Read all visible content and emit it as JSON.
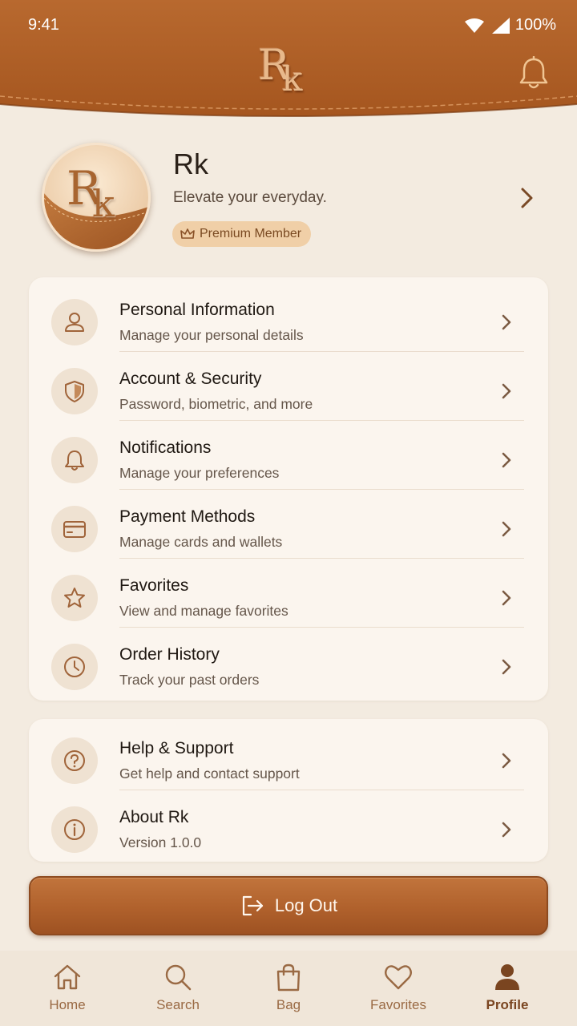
{
  "status_bar": {
    "time": "9:41",
    "battery": "100%"
  },
  "header": {
    "logo": "Rk"
  },
  "profile": {
    "name": "Rk",
    "tagline": "Elevate your everyday.",
    "badge": "Premium Member"
  },
  "account_menu": [
    {
      "title": "Personal Information",
      "subtitle": "Manage your personal details",
      "icon": "user-icon"
    },
    {
      "title": "Account & Security",
      "subtitle": "Password, biometric, and more",
      "icon": "shield-icon"
    },
    {
      "title": "Notifications",
      "subtitle": "Manage your preferences",
      "icon": "bell-icon"
    },
    {
      "title": "Payment Methods",
      "subtitle": "Manage cards and wallets",
      "icon": "credit-card-icon"
    },
    {
      "title": "Favorites",
      "subtitle": "View and manage favorites",
      "icon": "star-icon"
    },
    {
      "title": "Order History",
      "subtitle": "Track your past orders",
      "icon": "clock-icon"
    }
  ],
  "support_menu": [
    {
      "title": "Help & Support",
      "subtitle": "Get help and contact support",
      "icon": "question-icon"
    },
    {
      "title": "About Rk",
      "subtitle": "Version 1.0.0",
      "icon": "info-icon"
    }
  ],
  "logout_label": "Log Out",
  "bottom_nav": [
    {
      "label": "Home",
      "icon": "home-icon"
    },
    {
      "label": "Search",
      "icon": "search-icon"
    },
    {
      "label": "Bag",
      "icon": "bag-icon"
    },
    {
      "label": "Favorites",
      "icon": "heart-icon"
    },
    {
      "label": "Profile",
      "icon": "profile-icon",
      "active": true
    }
  ],
  "colors": {
    "leather": "#b3642e",
    "background": "#f3ebe0",
    "card": "#fbf5ee",
    "accent_text": "#7a4520"
  }
}
